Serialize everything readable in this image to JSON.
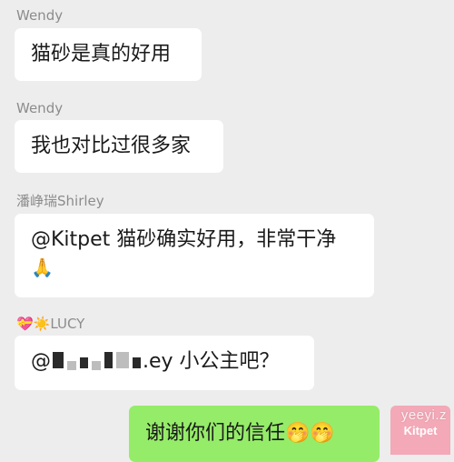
{
  "messages": [
    {
      "sender": "Wendy",
      "text": "猫砂是真的好用"
    },
    {
      "sender": "Wendy",
      "text": "我也对比过很多家"
    },
    {
      "sender": "潘峥瑞Shirley",
      "text_line1": "@Kitpet 猫砂确实好用，非常干净",
      "emoji_line2": "🙏"
    },
    {
      "sender_emoji": "💝☀️",
      "sender": "LUCY",
      "mention_prefix": "@",
      "mention_suffix": ".ey",
      "text": " 小公主吧？"
    },
    {
      "text": "谢谢你们的信任",
      "emoji": "🤭🤭"
    }
  ],
  "avatar": {
    "label": "Kitpet",
    "color": "#f3a9b7"
  },
  "watermark": "yeeyi.z",
  "colors": {
    "background": "#ededed",
    "bubble": "#ffffff",
    "self_bubble": "#95ec69"
  }
}
